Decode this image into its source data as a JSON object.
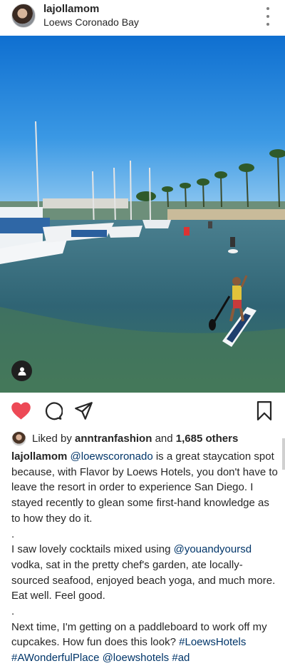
{
  "header": {
    "username": "lajollamom",
    "location": "Loews Coronado Bay",
    "avatar_icon": "profile-avatar",
    "more_icon": "vertical-ellipsis-icon"
  },
  "photo": {
    "description_icon": "user-tag-icon"
  },
  "actions": {
    "liked": true,
    "like_color": "#ed4956",
    "icons": [
      "heart-icon",
      "comment-icon",
      "share-icon",
      "bookmark-icon"
    ]
  },
  "likes": {
    "prefix": "Liked by",
    "user": "anntranfashion",
    "and": "and",
    "count": "1,685 others"
  },
  "caption": {
    "username": "lajollamom",
    "mention1": "@loewscoronado",
    "text1": " is a great staycation spot because, with Flavor by Loews Hotels, you don't have to leave the resort in order to experience San Diego. I stayed recently to glean some first-hand knowledge as to how they do it.",
    "dot1": ".",
    "text2a": "I saw lovely cocktails mixed using ",
    "mention2": "@youandyoursd",
    "text2b": " vodka, sat in the pretty chef's garden, ate locally-sourced seafood, enjoyed beach yoga, and much more. Eat well. Feel good.",
    "dot2": ".",
    "text3": "Next time, I'm getting on a paddleboard to work off my cupcakes. How fun does this look? ",
    "tag1": "#LoewsHotels",
    "tag2": "#AWonderfulPlace",
    "mention3": "@loewshotels",
    "tag3": "#ad",
    "link_color": "#003569"
  }
}
